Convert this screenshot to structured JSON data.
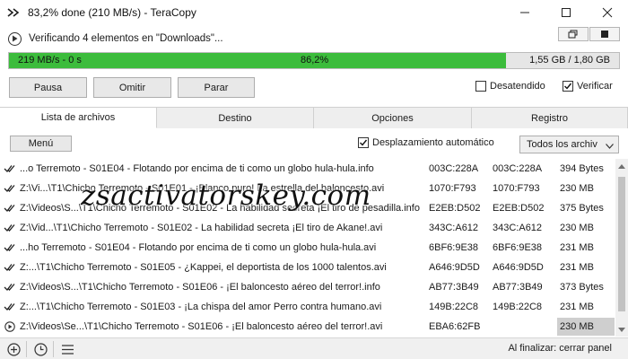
{
  "window": {
    "title": "83,2% done (210 MB/s) - TeraCopy"
  },
  "status": {
    "message": "Verificando 4 elementos en \"Downloads\"..."
  },
  "progress": {
    "speed": "219 MB/s - 0 s",
    "percent_text": "86,2%",
    "fraction": 0.815,
    "size": "1,55 GB / 1,80 GB"
  },
  "buttons": {
    "pause": "Pausa",
    "skip": "Omitir",
    "stop": "Parar"
  },
  "options": {
    "unattended": {
      "label": "Desatendido",
      "checked": false
    },
    "verify": {
      "label": "Verificar",
      "checked": true
    }
  },
  "tabs": [
    "Lista de archivos",
    "Destino",
    "Opciones",
    "Registro"
  ],
  "toolbar": {
    "menu": "Menú",
    "autoscroll": "Desplazamiento automático",
    "filter": "Todos los archiv"
  },
  "files": [
    {
      "name": "...o Terremoto - S01E04 - Flotando por encima de ti como un globo hula-hula.info",
      "hash1": "003C:228A",
      "hash2": "003C:228A",
      "size": "394 Bytes",
      "state": "done"
    },
    {
      "name": "Z:\\Vi...\\T1\\Chicho Terremoto - S01E01 - ¡Blanco puro! La estrella del baloncesto.avi",
      "hash1": "1070:F793",
      "hash2": "1070:F793",
      "size": "230 MB",
      "state": "done"
    },
    {
      "name": "Z:\\Videos\\S...\\T1\\Chicho Terremoto - S01E02 - La habilidad secreta ¡El tiro de pesadilla.info",
      "hash1": "E2EB:D502",
      "hash2": "E2EB:D502",
      "size": "375 Bytes",
      "state": "done"
    },
    {
      "name": "Z:\\Vid...\\T1\\Chicho Terremoto - S01E02 - La habilidad secreta ¡El tiro de Akane!.avi",
      "hash1": "343C:A612",
      "hash2": "343C:A612",
      "size": "230 MB",
      "state": "done"
    },
    {
      "name": "...ho Terremoto - S01E04 - Flotando por encima de ti como un globo hula-hula.avi",
      "hash1": "6BF6:9E38",
      "hash2": "6BF6:9E38",
      "size": "231 MB",
      "state": "done"
    },
    {
      "name": "Z:...\\T1\\Chicho Terremoto - S01E05 - ¿Kappei, el deportista de los 1000 talentos.avi",
      "hash1": "A646:9D5D",
      "hash2": "A646:9D5D",
      "size": "231 MB",
      "state": "done"
    },
    {
      "name": "Z:\\Videos\\S...\\T1\\Chicho Terremoto - S01E06 - ¡El baloncesto aéreo del terror!.info",
      "hash1": "AB77:3B49",
      "hash2": "AB77:3B49",
      "size": "373 Bytes",
      "state": "done"
    },
    {
      "name": "Z:...\\T1\\Chicho Terremoto - S01E03 - ¡La chispa del amor Perro contra humano.avi",
      "hash1": "149B:22C8",
      "hash2": "149B:22C8",
      "size": "231 MB",
      "state": "done"
    },
    {
      "name": "Z:\\Videos\\Se...\\T1\\Chicho Terremoto - S01E06 - ¡El baloncesto aéreo del terror!.avi",
      "hash1": "EBA6:62FB",
      "hash2": "",
      "size": "230 MB",
      "state": "current"
    }
  ],
  "footer": {
    "on_finish": "Al finalizar: cerrar panel"
  },
  "watermark": "zsactivatorskey.com",
  "icons": {
    "done": "checkmark-icon",
    "current": "play-circle-icon"
  },
  "colors": {
    "progress_fill": "#3cbc3c",
    "progress_track": "#e6e6e6"
  }
}
